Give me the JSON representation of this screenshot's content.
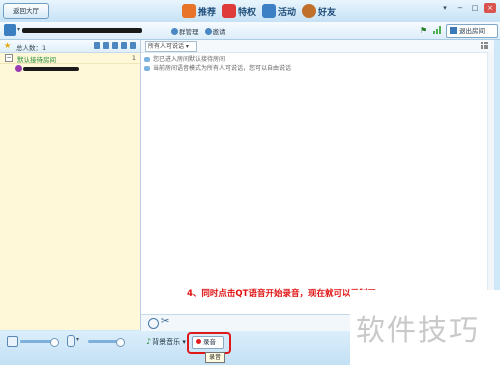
{
  "window": {
    "back_label": "返回大厅",
    "nav": [
      {
        "label": "推荐",
        "icon": "recommend-icon",
        "color": "#e8742a"
      },
      {
        "label": "特权",
        "icon": "privilege-icon",
        "color": "#e03b3b"
      },
      {
        "label": "活动",
        "icon": "activity-icon",
        "color": "#3d7fc4"
      },
      {
        "label": "好友",
        "icon": "friends-icon",
        "color": "#c0702a"
      }
    ]
  },
  "room_header": {
    "manage_label": "群管理",
    "invite_label": "邀请",
    "exit_label": "退出房间"
  },
  "member_panel": {
    "total_label": "总人数：1",
    "group": {
      "toggle": "−",
      "name": "默认接待房间",
      "count": "1"
    }
  },
  "chat": {
    "scope_select": "所有人可说话",
    "system_messages": [
      "您已进入房间默认接待房间",
      "当前房间语音模式为所有人可说话，您可以自由说话"
    ]
  },
  "instruction": "4、同时点击QT语音开始录音，现在就可以录制了",
  "bottom": {
    "bgm_label": "背景音乐",
    "record_label": "录音",
    "record_tooltip": "录音"
  },
  "watermark": "软件技巧"
}
